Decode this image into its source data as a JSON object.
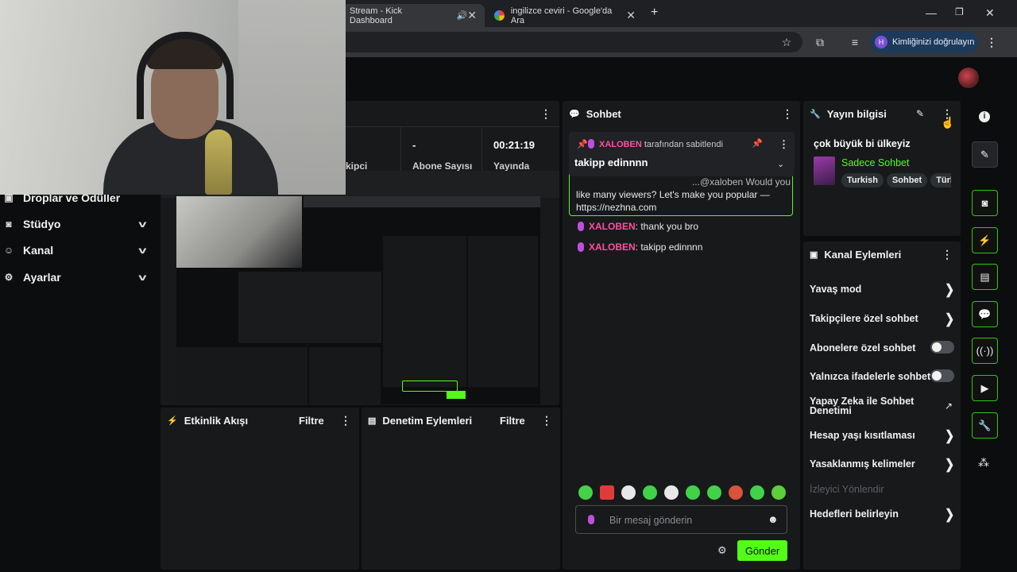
{
  "browser": {
    "tabs": [
      {
        "title": "Stream - Kick Dashboard"
      },
      {
        "title": "ingilizce ceviri - Google'da Ara"
      }
    ],
    "new_tab": "+",
    "profile_label": "Kimliğinizi doğrulayın",
    "profile_initial": "H"
  },
  "sidebar": {
    "items": [
      {
        "label": "Droplar ve Ödüller"
      },
      {
        "label": "Stüdyo"
      },
      {
        "label": "Kanal"
      },
      {
        "label": "Ayarlar"
      }
    ]
  },
  "stats": {
    "partial_label": "kipci",
    "subs_value": "-",
    "subs_label": "Abone Sayısı",
    "live_value": "00:21:19",
    "live_label": "Yayında"
  },
  "activity": {
    "title": "Etkinlik Akışı",
    "filter": "Filtre"
  },
  "moderation": {
    "title": "Denetim Eylemleri",
    "filter": "Filtre"
  },
  "chat": {
    "title": "Sohbet",
    "pinned_by_user": "XALOBEN",
    "pinned_by_suffix": "tarafından sabitlendi",
    "pinned_text": "takipp edinnnn",
    "hidden_msg": "like many viewers? Let's make you popular —",
    "hidden_msg_partial": "...@xaloben Would you",
    "hidden_link": "https://nezhna.com",
    "messages": [
      {
        "user": "XALOBEN",
        "text": ": thank you bro"
      },
      {
        "user": "XALOBEN",
        "text": ": takipp edinnnn"
      }
    ],
    "placeholder": "Bir mesaj gönderin",
    "send_label": "Gönder"
  },
  "stream_info": {
    "title": "Yayın bilgisi",
    "stream_title": "çok büyük bi ülkeyiz",
    "category": "Sadece Sohbet",
    "tags": [
      "Turkish",
      "Sohbet",
      "Türk"
    ]
  },
  "channel_actions": {
    "title": "Kanal Eylemleri",
    "items": [
      {
        "label": "Yavaş mod",
        "control": "chevron"
      },
      {
        "label": "Takipçilere özel sohbet",
        "control": "chevron"
      },
      {
        "label": "Abonelere özel sohbet",
        "control": "toggle"
      },
      {
        "label": "Yalnızca ifadelerle sohbet",
        "control": "toggle"
      },
      {
        "label": "Yapay Zeka ile Sohbet Denetimi",
        "control": "external"
      },
      {
        "label": "Hesap yaşı kısıtlaması",
        "control": "chevron"
      },
      {
        "label": "Yasaklanmış kelimeler",
        "control": "chevron"
      },
      {
        "label": "İzleyici Yönlendir",
        "control": "none"
      },
      {
        "label": "Hedefleri belirleyin",
        "control": "chevron"
      }
    ]
  },
  "colors": {
    "accent": "#53fc18",
    "username": "#ff4fa0",
    "panel": "#18191b"
  }
}
